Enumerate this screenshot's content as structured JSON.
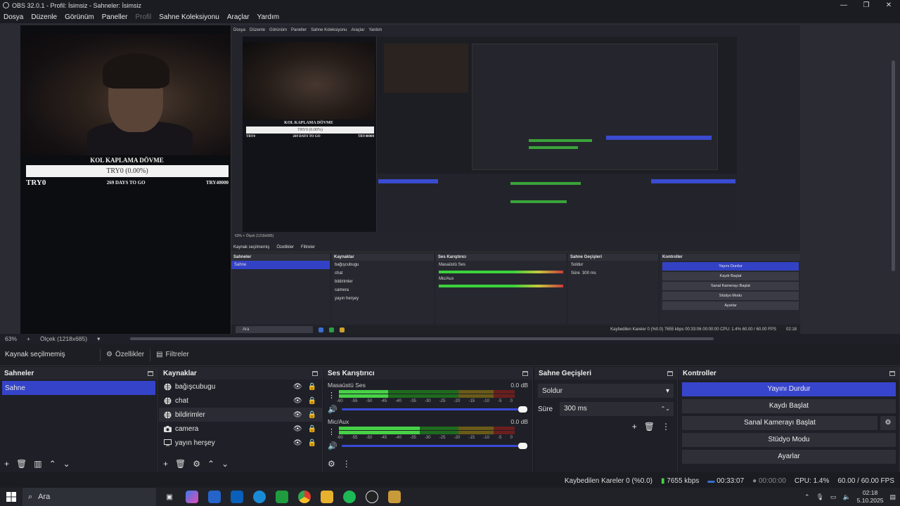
{
  "window": {
    "title": "OBS 32.0.1 - Profil: İsimsiz - Sahneler: İsimsiz",
    "minimize": "—",
    "restore": "❐",
    "close": "✕"
  },
  "menu": [
    "Dosya",
    "Düzenle",
    "Görünüm",
    "Paneller",
    "Profil",
    "Sahne Koleksiyonu",
    "Araçlar",
    "Yardım"
  ],
  "menu_disabled_index": 4,
  "overlay": {
    "title": "KOL KAPLAMA DÖVME",
    "bar": "TRY0 (0.00%)",
    "left": "TRY0",
    "middle": "269 DAYS TO GO",
    "right": "TRY40000"
  },
  "nested": {
    "menu": [
      "Dosya",
      "Düzenle",
      "Görünüm",
      "Paneller",
      "Sahne Koleksiyonu",
      "Araçlar",
      "Yardım"
    ],
    "overlay_title": "KOL KAPLAMA DÖVME",
    "overlay_bar": "TRY0 (0.00%)",
    "overlay_left": "TRY0",
    "overlay_middle": "269 DAYS TO GO",
    "overlay_right": "TRY40000",
    "status": "63%   +   Ölçek (1218x685)",
    "tabs": [
      "Kaynak seçilmemiş",
      "Özellikler",
      "Filtreler"
    ],
    "panels": {
      "scenes_title": "Sahneler",
      "scene": "Sahne",
      "sources_title": "Kaynaklar",
      "sources": [
        "bağışcubugu",
        "chat",
        "bildirimler",
        "camera",
        "yayın herşey"
      ],
      "mixer_title": "Ses Karıştırıcı",
      "mixer_ch1": "Masaüstü Ses",
      "mixer_ch2": "Mic/Aux",
      "trans_title": "Sahne Geçişleri",
      "trans_sel": "Soldur",
      "trans_dur_label": "Süre",
      "trans_dur": "300 ms",
      "ctrl_title": "Kontroller",
      "ctrl": [
        "Yayını Durdur",
        "Kaydı Başlat",
        "Sanal Kamerayı Başlat",
        "Stüdyo Modu",
        "Ayarlar"
      ]
    },
    "taskbar_search": "Ara",
    "taskbar_status": "Kaybedilen Kareler 0 (%0.0)   7655 kbps   00:33:06   00:00:00   CPU: 1.4%   60.00 / 60.00 FPS",
    "time": "02:18"
  },
  "zoom": {
    "percent": "63%",
    "plus": "+",
    "scale": "Ölçek (1218x685)"
  },
  "source_bar": {
    "label": "Kaynak seçilmemiş",
    "properties": "Özellikler",
    "filters": "Filtreler"
  },
  "scenes": {
    "title": "Sahneler",
    "items": [
      "Sahne"
    ]
  },
  "sources": {
    "title": "Kaynaklar",
    "items": [
      {
        "name": "bağışcubugu",
        "icon": "globe-icon"
      },
      {
        "name": "chat",
        "icon": "globe-icon"
      },
      {
        "name": "bildirimler",
        "icon": "globe-icon"
      },
      {
        "name": "camera",
        "icon": "camera-icon"
      },
      {
        "name": "yayın herşey",
        "icon": "monitor-icon"
      }
    ]
  },
  "mixer": {
    "title": "Ses Karıştırıcı",
    "channels": [
      {
        "name": "Masaüstü Ses",
        "db": "0.0 dB",
        "level_fraction": 0.28
      },
      {
        "name": "Mic/Aux",
        "db": "0.0 dB",
        "level_fraction": 0.46
      }
    ],
    "ticks": [
      "-60",
      "-55",
      "-50",
      "-45",
      "-40",
      "-35",
      "-30",
      "-25",
      "-20",
      "-15",
      "-10",
      "-5",
      "0"
    ]
  },
  "transitions": {
    "title": "Sahne Geçişleri",
    "selected": "Soldur",
    "duration_label": "Süre",
    "duration": "300 ms"
  },
  "controls": {
    "title": "Kontroller",
    "stop_stream": "Yayını Durdur",
    "start_record": "Kaydı Başlat",
    "start_vcam": "Sanal Kamerayı Başlat",
    "studio_mode": "Stüdyo Modu",
    "settings": "Ayarlar"
  },
  "status": {
    "dropped": "Kaybedilen Kareler 0 (%0.0)",
    "bitrate": "7655 kbps",
    "stream_time": "00:33:07",
    "record_time": "00:00:00",
    "cpu": "CPU: 1.4%",
    "fps": "60.00 / 60.00 FPS"
  },
  "taskbar": {
    "search": "Ara",
    "time": "02:18",
    "date": "5.10.2025"
  },
  "colors": {
    "accent": "#3443c8",
    "bg": "#1f2027",
    "meter_green": "#46d146"
  }
}
